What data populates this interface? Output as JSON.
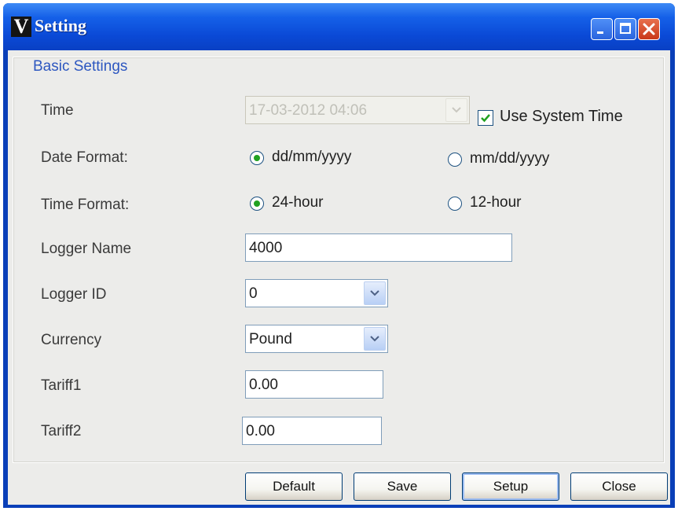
{
  "window": {
    "title": "Setting",
    "icon_letter": "V"
  },
  "group": {
    "title": "Basic Settings"
  },
  "time": {
    "label": "Time",
    "value": "17-03-2012 04:06",
    "use_system_time_label": "Use System Time",
    "use_system_time_checked": true
  },
  "date_format": {
    "label": "Date Format:",
    "options": [
      "dd/mm/yyyy",
      "mm/dd/yyyy"
    ],
    "selected": "dd/mm/yyyy"
  },
  "time_format": {
    "label": "Time Format:",
    "options": [
      "24-hour",
      "12-hour"
    ],
    "selected": "24-hour"
  },
  "logger_name": {
    "label": "Logger Name",
    "value": "4000"
  },
  "logger_id": {
    "label": "Logger ID",
    "value": "0"
  },
  "currency": {
    "label": "Currency",
    "value": "Pound"
  },
  "tariff1": {
    "label": "Tariff1",
    "value": "0.00"
  },
  "tariff2": {
    "label": "Tariff2",
    "value": "0.00"
  },
  "buttons": {
    "default": "Default",
    "save": "Save",
    "setup": "Setup",
    "close": "Close"
  },
  "colors": {
    "titlebar": "#0a49d6",
    "accent_text": "#2d57c0",
    "radio_selected": "#21a121"
  },
  "icons": [
    "minimize-icon",
    "maximize-icon",
    "close-icon",
    "chevron-down-icon",
    "checkmark-icon"
  ]
}
